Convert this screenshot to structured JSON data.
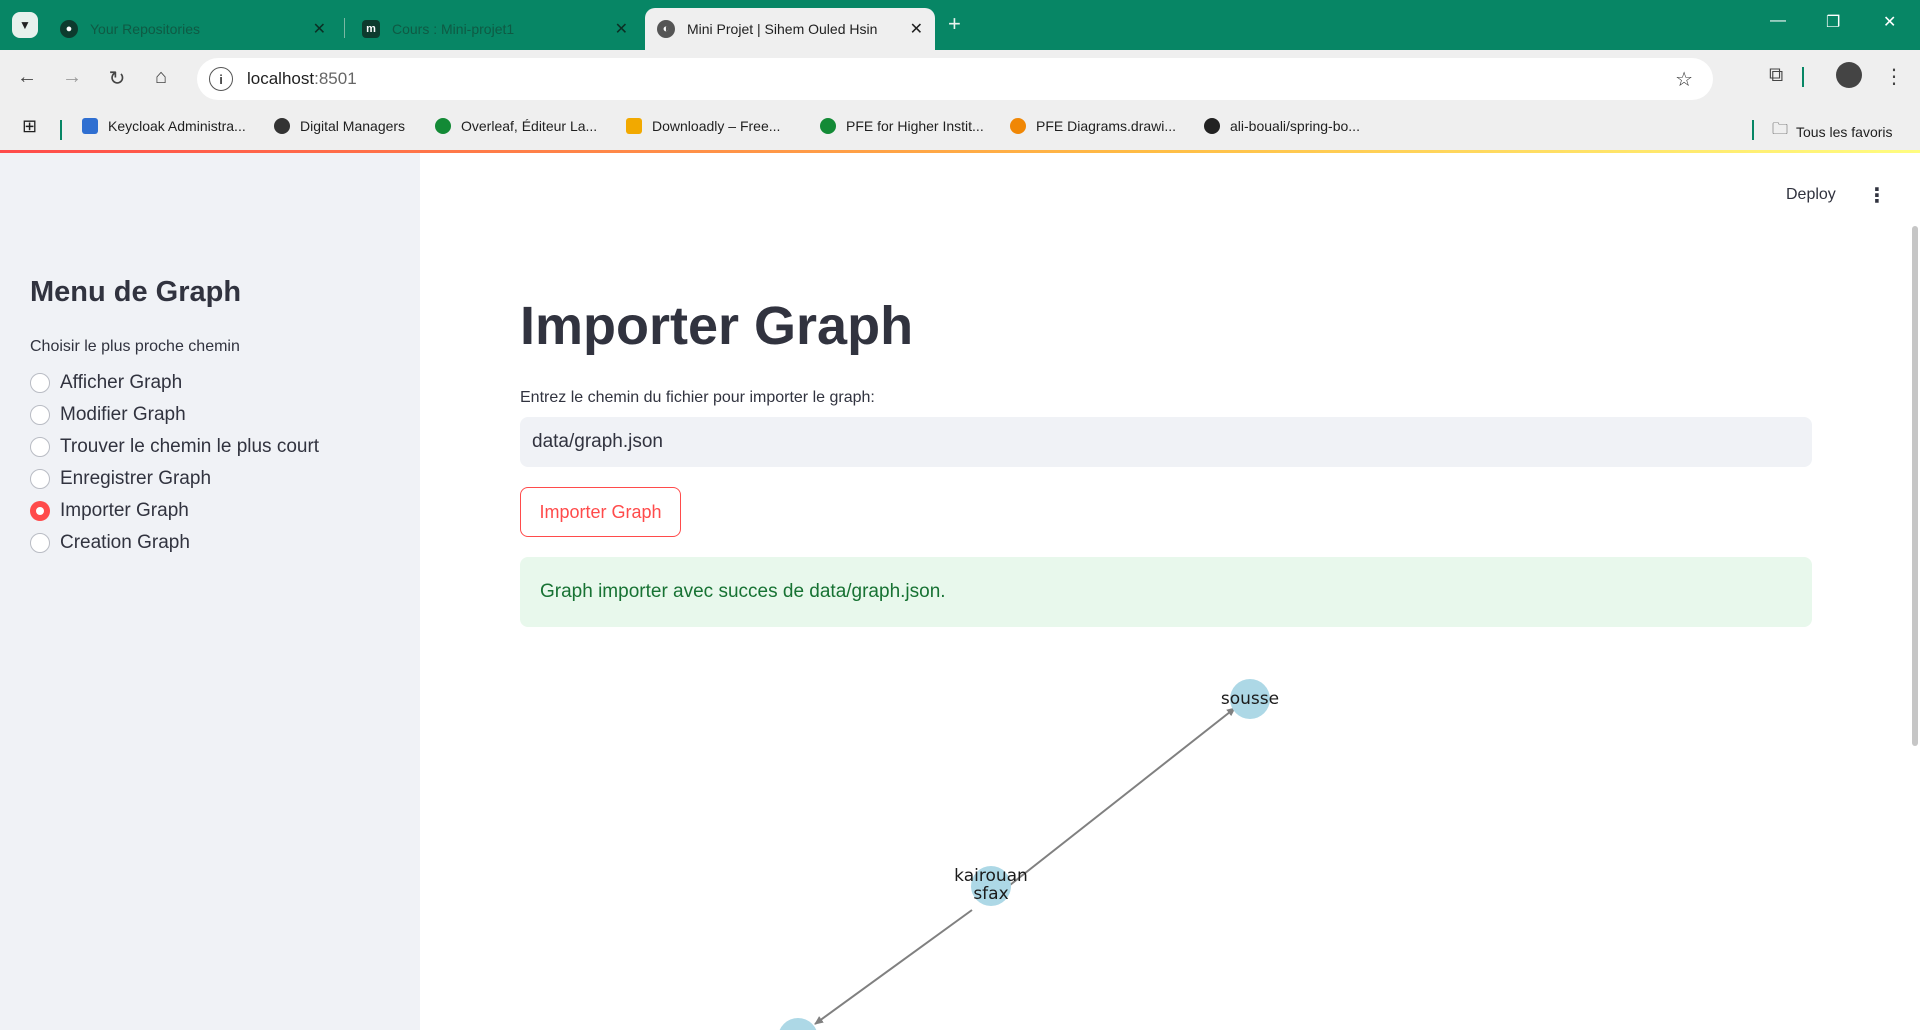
{
  "browser": {
    "tabs": [
      {
        "title": "Your Repositories",
        "icon": "github-icon",
        "active": false
      },
      {
        "title": "Cours : Mini-projet1",
        "icon": "moodle-icon",
        "active": false
      },
      {
        "title": "Mini Projet | Sihem Ouled Hsin",
        "icon": "streamlit-avatar-icon",
        "active": true
      }
    ],
    "url_host": "localhost",
    "url_port": ":8501",
    "bookmarks": [
      {
        "label": "Keycloak Administra...",
        "icon": "keycloak-icon",
        "color": "#2f6fd1"
      },
      {
        "label": "Digital Managers",
        "icon": "feather-icon",
        "color": "#333333"
      },
      {
        "label": "Overleaf, Éditeur La...",
        "icon": "overleaf-icon",
        "color": "#138a36"
      },
      {
        "label": "Downloadly – Free...",
        "icon": "downloadly-icon",
        "color": "#f2a900"
      },
      {
        "label": "PFE for Higher Instit...",
        "icon": "overleaf-icon",
        "color": "#138a36"
      },
      {
        "label": "PFE Diagrams.drawi...",
        "icon": "drawio-icon",
        "color": "#f08705"
      },
      {
        "label": "ali-bouali/spring-bo...",
        "icon": "github-icon",
        "color": "#222222"
      }
    ],
    "all_bookmarks": "Tous les favoris"
  },
  "sidebar": {
    "title": "Menu de Graph",
    "radio_label": "Choisir le plus proche chemin",
    "options": [
      {
        "label": "Afficher Graph",
        "selected": false
      },
      {
        "label": "Modifier Graph",
        "selected": false
      },
      {
        "label": "Trouver le chemin le plus court",
        "selected": false
      },
      {
        "label": "Enregistrer Graph",
        "selected": false
      },
      {
        "label": "Importer Graph",
        "selected": true
      },
      {
        "label": "Creation Graph",
        "selected": false
      }
    ]
  },
  "header": {
    "deploy_label": "Deploy"
  },
  "main": {
    "title": "Importer Graph",
    "input_label": "Entrez le chemin du fichier pour importer le graph:",
    "input_value": "data/graph.json",
    "button_label": "Importer Graph",
    "success_message": "Graph importer avec succes de data/graph.json."
  },
  "graph": {
    "node_color": "#add8e6",
    "edge_color": "#808080",
    "nodes": [
      {
        "id": "sousse",
        "label": "sousse"
      },
      {
        "id": "kairouan-sfax",
        "label_lines": [
          "kairouan",
          "sfax"
        ]
      },
      {
        "id": "bottom",
        "label_lines": []
      }
    ],
    "edges": [
      {
        "from": "kairouan-sfax",
        "to": "sousse"
      },
      {
        "from": "kairouan-sfax",
        "to": "bottom"
      }
    ]
  }
}
